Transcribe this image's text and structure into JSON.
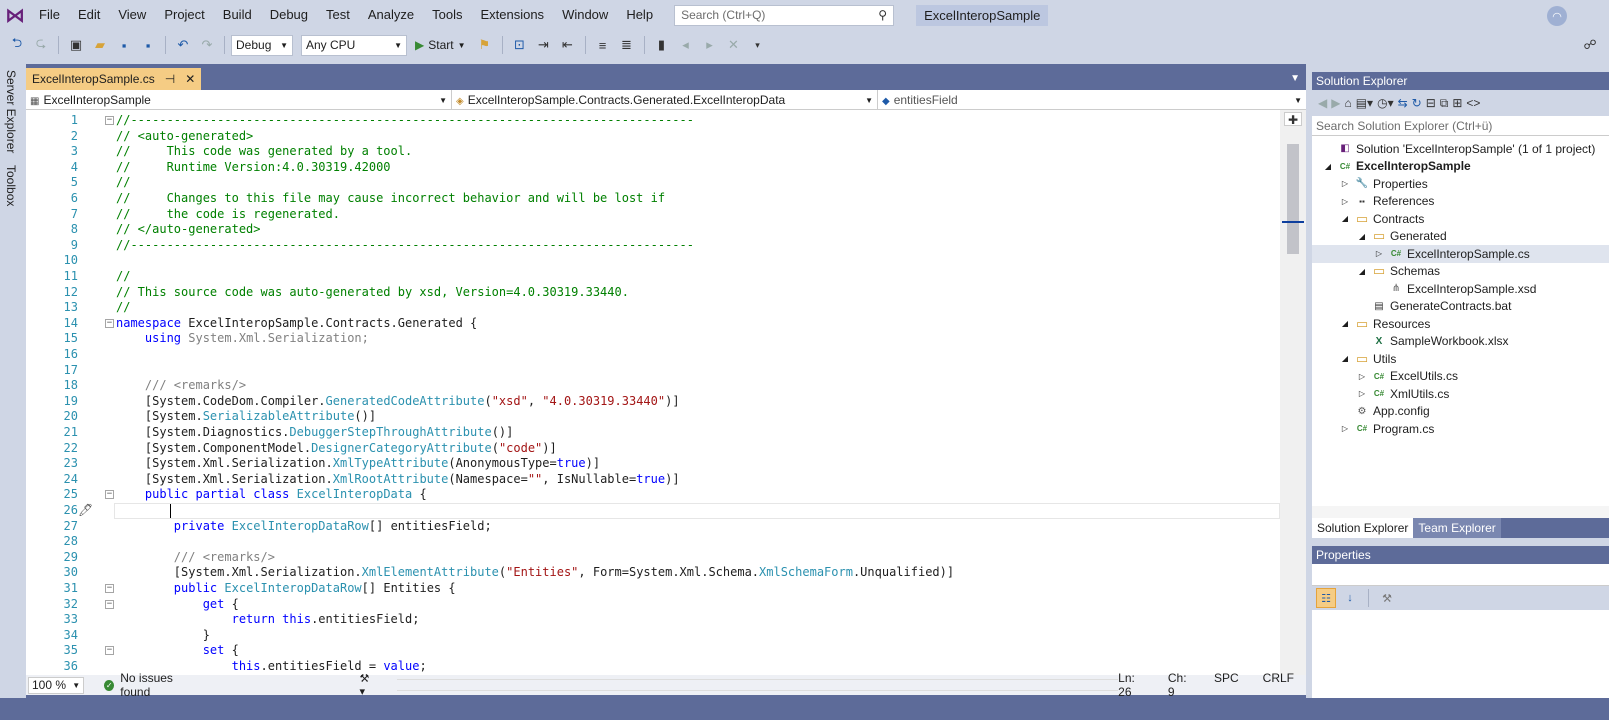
{
  "menu": {
    "items": [
      "File",
      "Edit",
      "View",
      "Project",
      "Build",
      "Debug",
      "Test",
      "Analyze",
      "Tools",
      "Extensions",
      "Window",
      "Help"
    ],
    "search_placeholder": "Search (Ctrl+Q)",
    "solution_title": "ExcelInteropSample"
  },
  "toolbar": {
    "config": "Debug",
    "platform": "Any CPU",
    "start_label": "Start"
  },
  "left_tabs": [
    "Server Explorer",
    "Toolbox"
  ],
  "doc_tab": {
    "label": "ExcelInteropSample.cs",
    "pin": "⊣",
    "close": "✕"
  },
  "navbar": {
    "project": "ExcelInteropSample",
    "type": "ExcelInteropSample.Contracts.Generated.ExcelInteropData",
    "member": "entitiesField"
  },
  "code_lines": [
    {
      "n": "1",
      "fold": "-",
      "html": "<span class='cm'>//------------------------------------------------------------------------------</span>"
    },
    {
      "n": "2",
      "html": "<span class='cm'>// &lt;auto-generated&gt;</span>"
    },
    {
      "n": "3",
      "html": "<span class='cm'>//     This code was generated by a tool.</span>"
    },
    {
      "n": "4",
      "html": "<span class='cm'>//     Runtime Version:4.0.30319.42000</span>"
    },
    {
      "n": "5",
      "html": "<span class='cm'>//</span>"
    },
    {
      "n": "6",
      "html": "<span class='cm'>//     Changes to this file may cause incorrect behavior and will be lost if</span>"
    },
    {
      "n": "7",
      "html": "<span class='cm'>//     the code is regenerated.</span>"
    },
    {
      "n": "8",
      "html": "<span class='cm'>// &lt;/auto-generated&gt;</span>"
    },
    {
      "n": "9",
      "html": "<span class='cm'>//------------------------------------------------------------------------------</span>"
    },
    {
      "n": "10",
      "html": ""
    },
    {
      "n": "11",
      "html": "<span class='cm'>//</span>"
    },
    {
      "n": "12",
      "html": "<span class='cm'>// This source code was auto-generated by xsd, Version=4.0.30319.33440.</span>"
    },
    {
      "n": "13",
      "html": "<span class='cm'>//</span>"
    },
    {
      "n": "14",
      "fold": "-",
      "html": "<span class='kw'>namespace</span> ExcelInteropSample.Contracts.Generated {"
    },
    {
      "n": "15",
      "html": "    <span class='kw'>using</span> <span class='gr'>System.Xml.Serialization;</span>"
    },
    {
      "n": "16",
      "html": ""
    },
    {
      "n": "17",
      "html": ""
    },
    {
      "n": "18",
      "html": "    <span class='gr'>/// &lt;remarks/&gt;</span>"
    },
    {
      "n": "19",
      "html": "    [System.CodeDom.Compiler.<span class='ty'>GeneratedCodeAttribute</span>(<span class='st'>\"xsd\"</span>, <span class='st'>\"4.0.30319.33440\"</span>)]"
    },
    {
      "n": "20",
      "html": "    [System.<span class='ty'>SerializableAttribute</span>()]"
    },
    {
      "n": "21",
      "html": "    [System.Diagnostics.<span class='ty'>DebuggerStepThroughAttribute</span>()]"
    },
    {
      "n": "22",
      "html": "    [System.ComponentModel.<span class='ty'>DesignerCategoryAttribute</span>(<span class='st'>\"code\"</span>)]"
    },
    {
      "n": "23",
      "html": "    [System.Xml.Serialization.<span class='ty'>XmlTypeAttribute</span>(AnonymousType=<span class='kw'>true</span>)]"
    },
    {
      "n": "24",
      "html": "    [System.Xml.Serialization.<span class='ty'>XmlRootAttribute</span>(Namespace=<span class='st'>\"\"</span>, IsNullable=<span class='kw'>true</span>)]"
    },
    {
      "n": "25",
      "fold": "-",
      "html": "    <span class='kw'>public partial class</span> <span class='ty'>ExcelInteropData</span> {"
    },
    {
      "n": "26",
      "html": ""
    },
    {
      "n": "27",
      "html": "        <span class='kw'>private</span> <span class='ty'>ExcelInteropDataRow</span>[] entitiesField;"
    },
    {
      "n": "28",
      "html": ""
    },
    {
      "n": "29",
      "html": "        <span class='gr'>/// &lt;remarks/&gt;</span>"
    },
    {
      "n": "30",
      "html": "        [System.Xml.Serialization.<span class='ty'>XmlElementAttribute</span>(<span class='st'>\"Entities\"</span>, Form=System.Xml.Schema.<span class='ty'>XmlSchemaForm</span>.Unqualified)]"
    },
    {
      "n": "31",
      "fold": "-",
      "html": "        <span class='kw'>public</span> <span class='ty'>ExcelInteropDataRow</span>[] Entities {"
    },
    {
      "n": "32",
      "fold": "-",
      "html": "            <span class='kw'>get</span> {"
    },
    {
      "n": "33",
      "html": "                <span class='kw'>return this</span>.entitiesField;"
    },
    {
      "n": "34",
      "html": "            }"
    },
    {
      "n": "35",
      "fold": "-",
      "html": "            <span class='kw'>set</span> {"
    },
    {
      "n": "36",
      "html": "                <span class='kw'>this</span>.entitiesField = <span class='kw'>value</span>;"
    }
  ],
  "status": {
    "zoom": "100 %",
    "issues": "No issues found",
    "line": "Ln: 26",
    "col": "Ch: 9",
    "spacing": "SPC",
    "eol": "CRLF"
  },
  "solution_explorer": {
    "title": "Solution Explorer",
    "search_placeholder": "Search Solution Explorer (Ctrl+ü)",
    "tree": [
      {
        "label": "Solution 'ExcelInteropSample' (1 of 1 project)",
        "level": 0,
        "exp": "",
        "icon": "sln",
        "bold": false
      },
      {
        "label": "ExcelInteropSample",
        "level": 0,
        "exp": "◢",
        "icon": "cs",
        "bold": true
      },
      {
        "label": "Properties",
        "level": 1,
        "exp": "▷",
        "icon": "wrench",
        "bold": false
      },
      {
        "label": "References",
        "level": 1,
        "exp": "▷",
        "icon": "ref",
        "bold": false
      },
      {
        "label": "Contracts",
        "level": 1,
        "exp": "◢",
        "icon": "folder",
        "bold": false
      },
      {
        "label": "Generated",
        "level": 2,
        "exp": "◢",
        "icon": "folder",
        "bold": false
      },
      {
        "label": "ExcelInteropSample.cs",
        "level": 3,
        "exp": "▷",
        "icon": "cs",
        "bold": false,
        "selected": true
      },
      {
        "label": "Schemas",
        "level": 2,
        "exp": "◢",
        "icon": "folder",
        "bold": false
      },
      {
        "label": "ExcelInteropSample.xsd",
        "level": 3,
        "exp": "",
        "icon": "xsd",
        "bold": false
      },
      {
        "label": "GenerateContracts.bat",
        "level": 2,
        "exp": "",
        "icon": "bat",
        "bold": false
      },
      {
        "label": "Resources",
        "level": 1,
        "exp": "◢",
        "icon": "folder",
        "bold": false
      },
      {
        "label": "SampleWorkbook.xlsx",
        "level": 2,
        "exp": "",
        "icon": "xls",
        "bold": false
      },
      {
        "label": "Utils",
        "level": 1,
        "exp": "◢",
        "icon": "folder",
        "bold": false
      },
      {
        "label": "ExcelUtils.cs",
        "level": 2,
        "exp": "▷",
        "icon": "cs",
        "bold": false
      },
      {
        "label": "XmlUtils.cs",
        "level": 2,
        "exp": "▷",
        "icon": "cs",
        "bold": false
      },
      {
        "label": "App.config",
        "level": 1,
        "exp": "",
        "icon": "config",
        "bold": false
      },
      {
        "label": "Program.cs",
        "level": 1,
        "exp": "▷",
        "icon": "cs",
        "bold": false
      }
    ],
    "tabs": [
      "Solution Explorer",
      "Team Explorer"
    ]
  },
  "properties": {
    "title": "Properties"
  }
}
